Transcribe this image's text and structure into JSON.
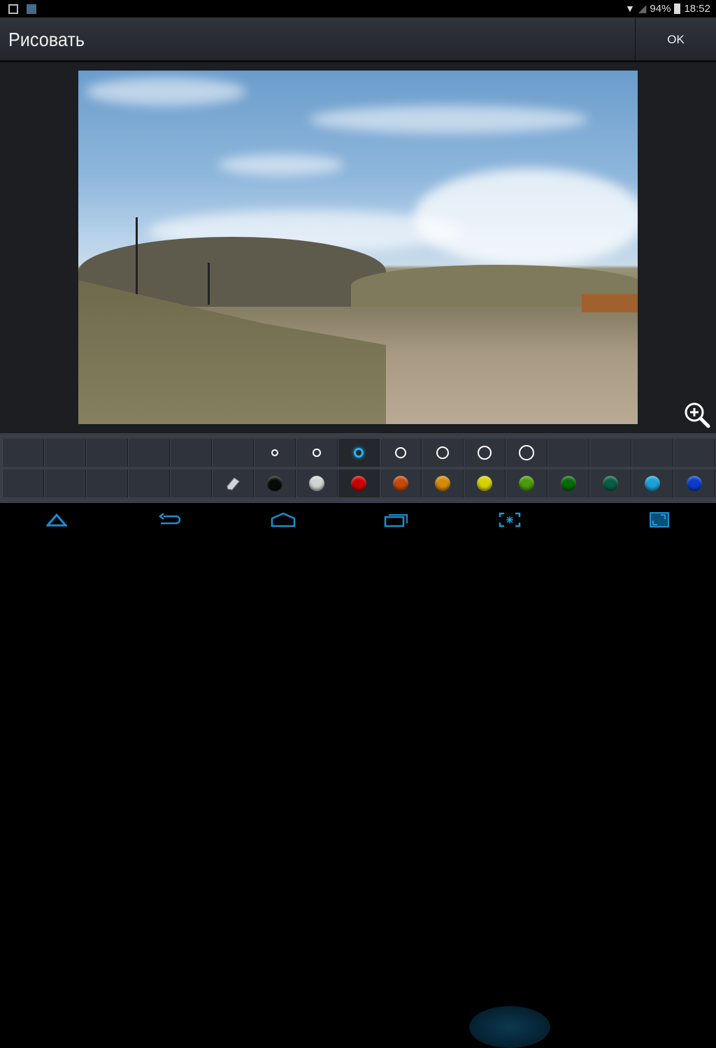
{
  "status": {
    "battery": "94%",
    "time": "18:52"
  },
  "actionbar": {
    "title": "Рисовать",
    "ok_label": "OK"
  },
  "palette": {
    "sizes": [
      {
        "size": 4,
        "selected": false
      },
      {
        "size": 5,
        "selected": false
      },
      {
        "size": 6,
        "selected": true
      },
      {
        "size": 7,
        "selected": false
      },
      {
        "size": 8,
        "selected": false
      },
      {
        "size": 9,
        "selected": false
      },
      {
        "size": 10,
        "selected": false
      }
    ],
    "colors": [
      {
        "name": "black",
        "hex": "#0a0a0a"
      },
      {
        "name": "white",
        "hex": "#d4d4d4"
      },
      {
        "name": "red",
        "hex": "#cc0000",
        "selected": true
      },
      {
        "name": "orange",
        "hex": "#c44a08"
      },
      {
        "name": "amber",
        "hex": "#d58a05"
      },
      {
        "name": "yellow",
        "hex": "#d8d000"
      },
      {
        "name": "lime",
        "hex": "#4c9a08"
      },
      {
        "name": "green",
        "hex": "#066a06"
      },
      {
        "name": "teal",
        "hex": "#075e44"
      },
      {
        "name": "sky",
        "hex": "#1aa3d6"
      },
      {
        "name": "blue",
        "hex": "#0a3ccc"
      }
    ]
  },
  "accent": "#1a9ad6"
}
